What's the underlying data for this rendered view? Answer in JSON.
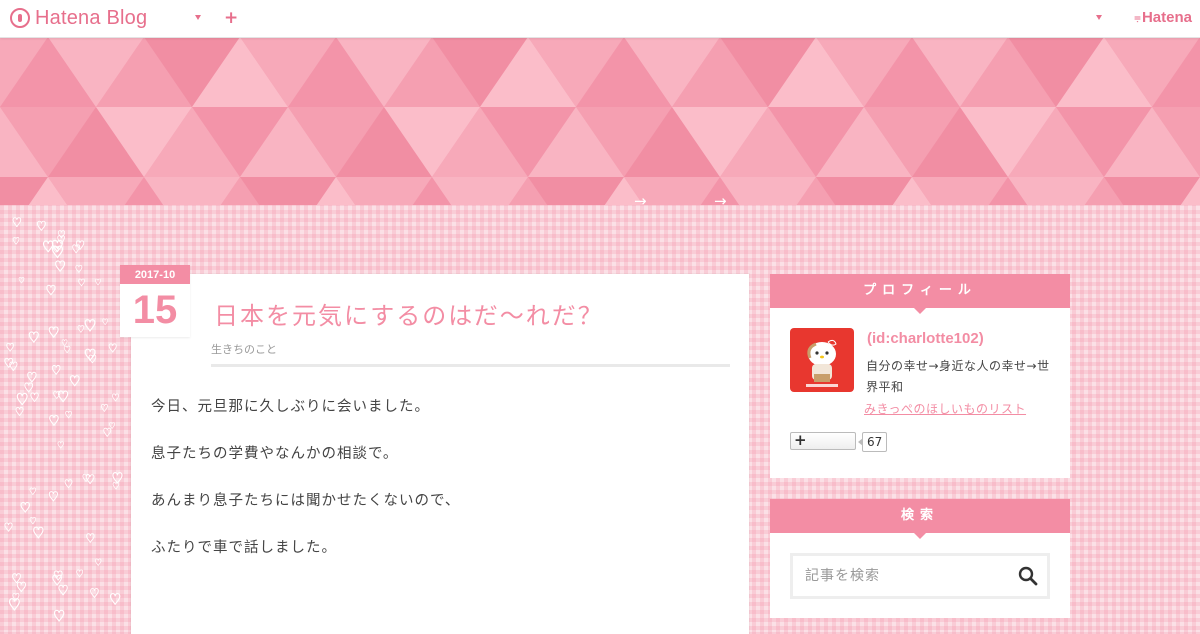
{
  "topbar": {
    "logo_text": "Hatena Blog",
    "add_label": "+",
    "right_brand": "Hatena"
  },
  "banner": {
    "arrows": [
      "→",
      "→"
    ]
  },
  "entry": {
    "date_ym": "2017-10",
    "date_day": "15",
    "title": "日本を元気にするのはだ〜れだ？",
    "category": "生きちのこと",
    "paragraphs": [
      "今日、元旦那に久しぶりに会いました。",
      "息子たちの学費やなんかの相談で。",
      "あんまり息子たちには聞かせたくないので、",
      "ふたりで車で話しました。"
    ]
  },
  "sidebar": {
    "profile": {
      "heading": "プロフィール",
      "user_id": "(id:charlotte102)",
      "description": "自分の幸せ→身近な人の幸せ→世界平和",
      "wishlist_link": "みきっぺのほしいものリスト",
      "follow_label": "+",
      "follow_count": "67"
    },
    "search": {
      "heading": "検索",
      "placeholder": "記事を検索"
    }
  },
  "colors": {
    "accent": "#f38da4",
    "banner": "#f6a1b3",
    "brand": "#e76f8c"
  }
}
